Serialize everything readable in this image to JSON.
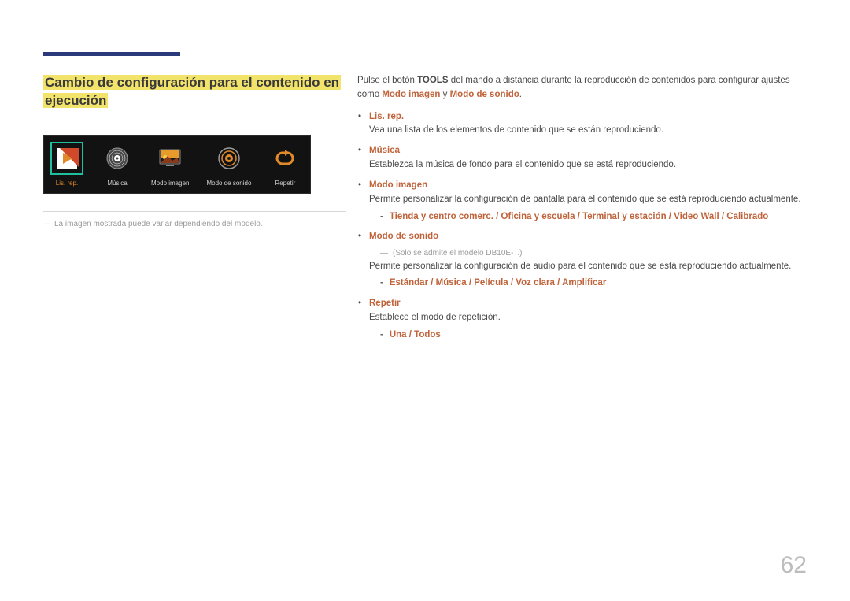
{
  "section_title_line1": "Cambio de configuración para el contenido en",
  "section_title_line2": "ejecución",
  "toolbar": {
    "items": [
      {
        "label": "Lis. rep."
      },
      {
        "label": "Música"
      },
      {
        "label": "Modo imagen"
      },
      {
        "label": "Modo de sonido"
      },
      {
        "label": "Repetir"
      }
    ]
  },
  "left_note": "La imagen mostrada puede variar dependiendo del modelo.",
  "intro": {
    "p1a": "Pulse el botón ",
    "p1b": "TOOLS",
    "p1c": " del mando a distancia durante la reproducción de contenidos para configurar ajustes como ",
    "p1d": "Modo imagen",
    "p1e": " y ",
    "p1f": "Modo de sonido",
    "p1g": "."
  },
  "items": {
    "lisrep": {
      "title": "Lis. rep.",
      "desc": "Vea una lista de los elementos de contenido que se están reproduciendo."
    },
    "musica": {
      "title": "Música",
      "desc": "Establezca la música de fondo para el contenido que se está reproduciendo."
    },
    "modoimagen": {
      "title": "Modo imagen",
      "desc": "Permite personalizar la configuración de pantalla para el contenido que se está reproduciendo actualmente.",
      "sub": "Tienda y centro comerc. / Oficina y escuela / Terminal y estación / Video Wall / Calibrado"
    },
    "modosonido": {
      "title": "Modo de sonido",
      "note": "(Solo se admite el modelo DB10E-T.)",
      "desc": "Permite personalizar la configuración de audio para el contenido que se está reproduciendo actualmente.",
      "sub": "Estándar / Música / Película / Voz clara / Amplificar"
    },
    "repetir": {
      "title": "Repetir",
      "desc": "Establece el modo de repetición.",
      "sub": "Una / Todos"
    }
  },
  "page_number": "62"
}
